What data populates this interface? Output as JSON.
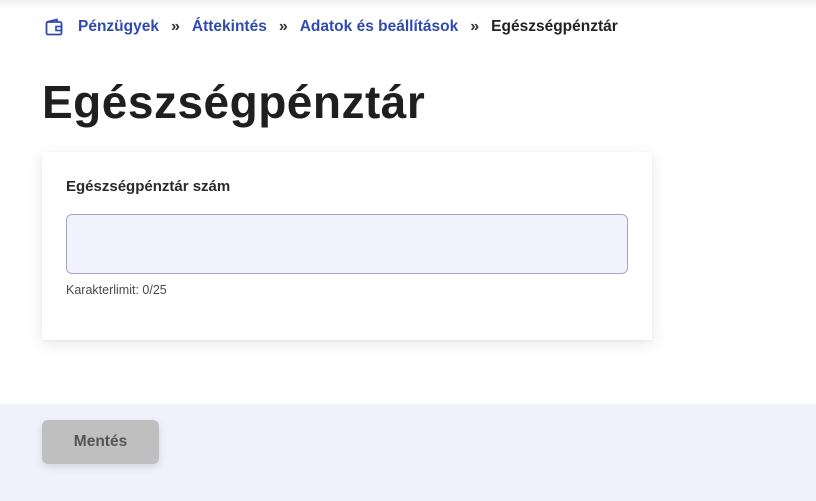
{
  "breadcrumb": {
    "icon": "wallet-icon",
    "items": [
      {
        "label": "Pénzügyek"
      },
      {
        "label": "Áttekintés"
      },
      {
        "label": "Adatok és beállítások"
      }
    ],
    "separator": "»",
    "current": "Egészségpénztár"
  },
  "page": {
    "title": "Egészségpénztár"
  },
  "form": {
    "field_label": "Egészségpénztár szám",
    "field_value": "",
    "char_limit": "Karakterlimit: 0/25"
  },
  "footer": {
    "save_label": "Mentés"
  },
  "colors": {
    "link": "#2f4bb0",
    "input_bg": "#f2f2fc",
    "input_border": "#a3a3cf",
    "footer_bg": "#f1f1fb",
    "button_disabled": "#bfbfbf"
  }
}
